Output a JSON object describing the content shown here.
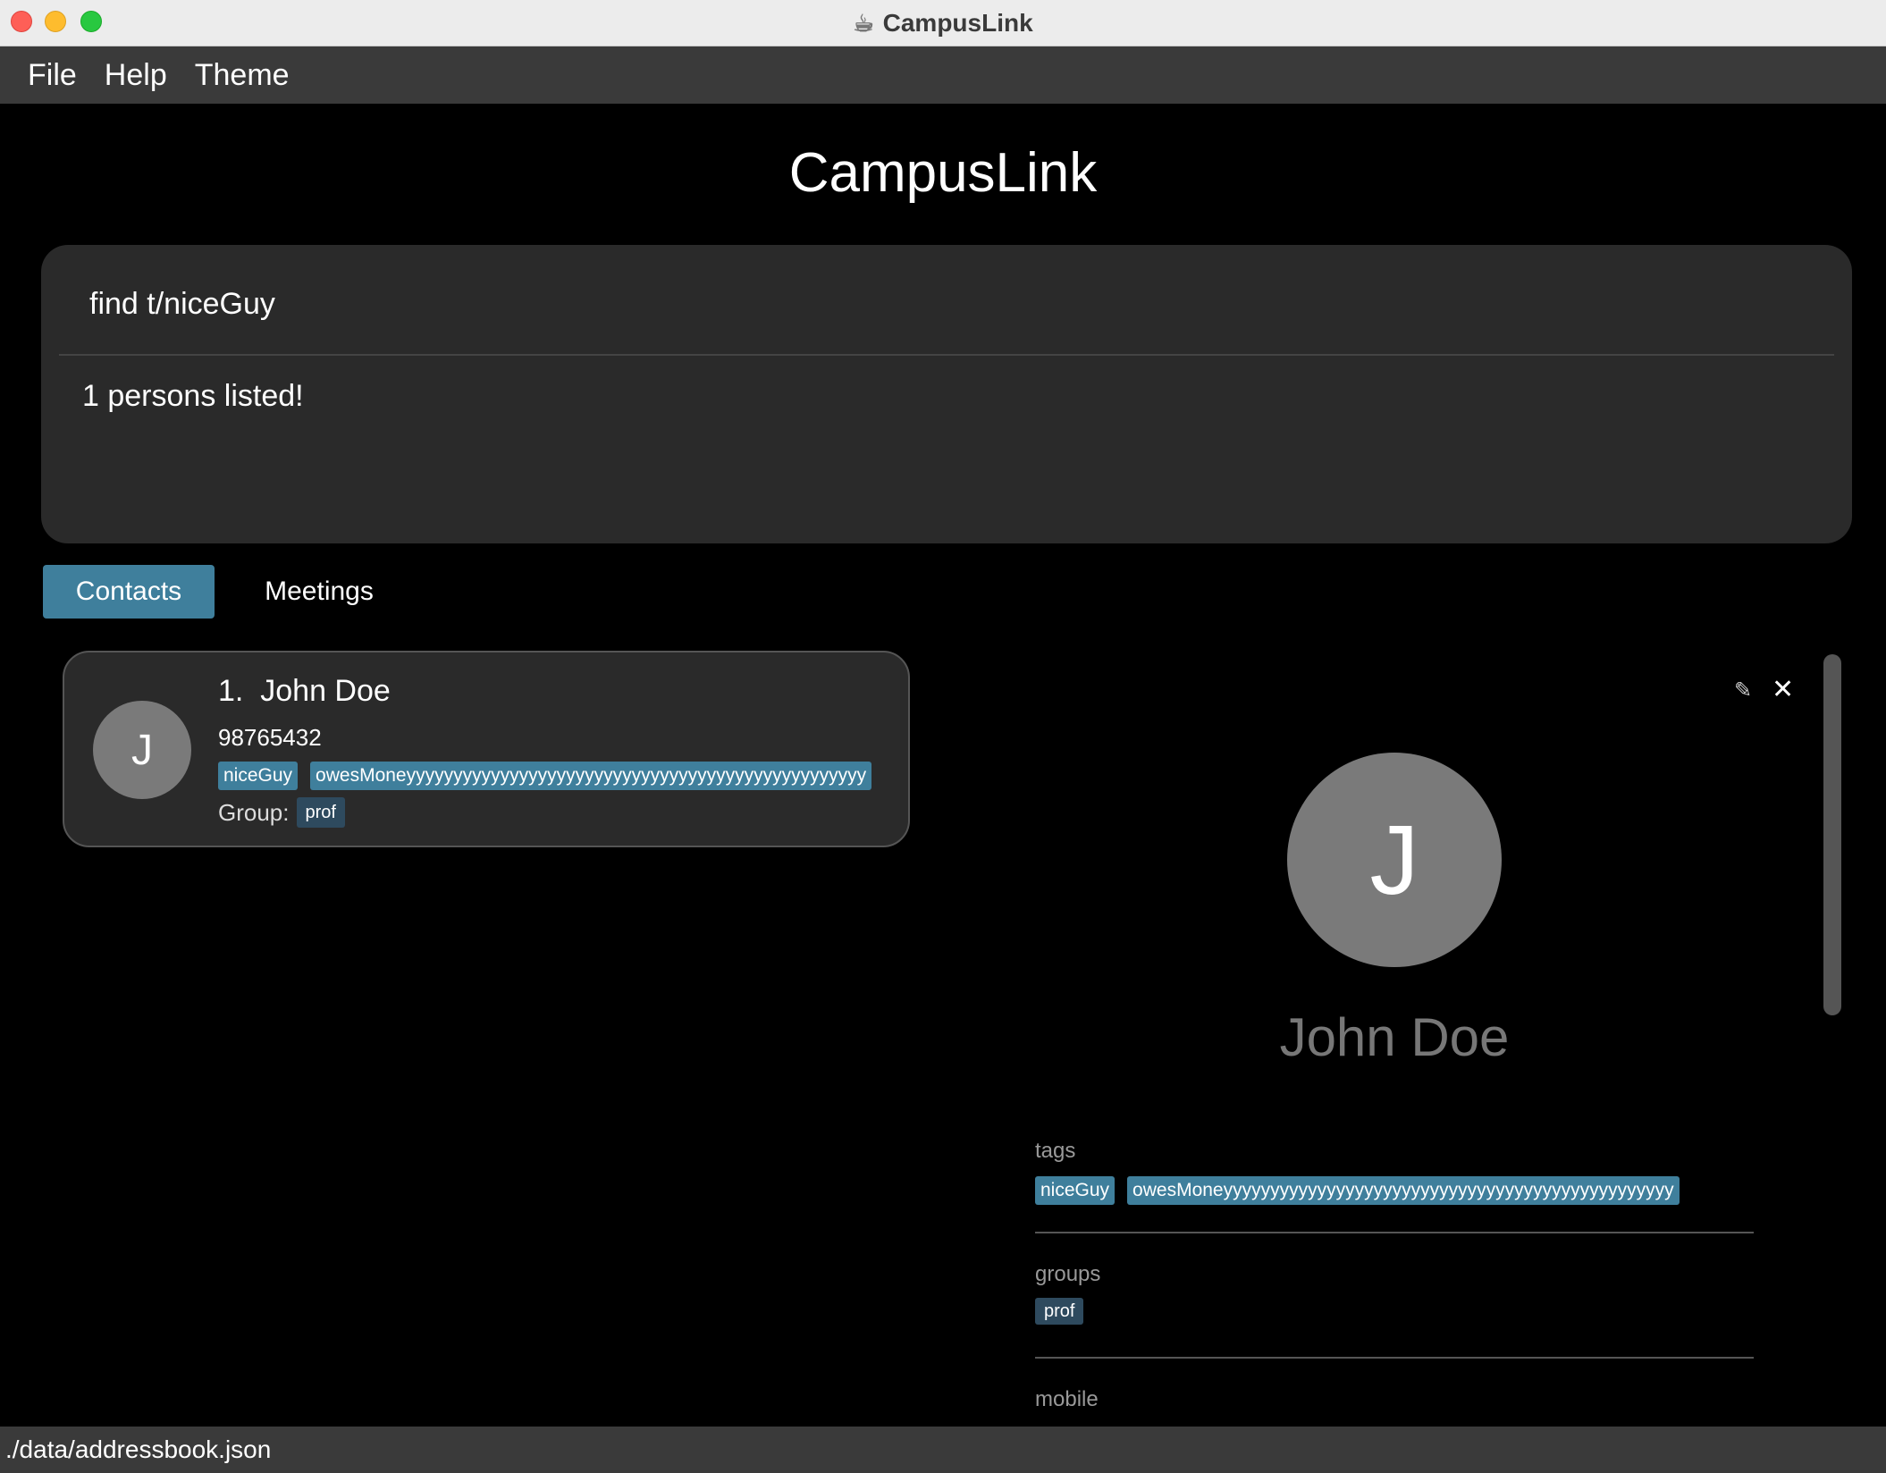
{
  "window": {
    "title": "CampusLink"
  },
  "menu": {
    "file": "File",
    "help": "Help",
    "theme": "Theme"
  },
  "header": {
    "title": "CampusLink"
  },
  "command": {
    "input_value": "find t/niceGuy",
    "result": "1 persons listed!"
  },
  "tabs": [
    {
      "label": "Contacts",
      "active": true
    },
    {
      "label": "Meetings",
      "active": false
    }
  ],
  "contacts": [
    {
      "index_name": "1.  John Doe",
      "initial": "J",
      "phone": "98765432",
      "tags": [
        "niceGuy",
        "owesMoneyyyyyyyyyyyyyyyyyyyyyyyyyyyyyyyyyyyyyyyyyyyyyyyyy"
      ],
      "group_label": "Group:",
      "group": "prof"
    }
  ],
  "detail": {
    "initial": "J",
    "name": "John Doe",
    "edit_icon": "✎",
    "close_icon": "✕",
    "tags_label": "tags",
    "tags": [
      "niceGuy",
      "owesMoneyyyyyyyyyyyyyyyyyyyyyyyyyyyyyyyyyyyyyyyyyyyyyyyy"
    ],
    "groups_label": "groups",
    "group": "prof",
    "mobile_label": "mobile"
  },
  "status": {
    "path": "./data/addressbook.json"
  },
  "colors": {
    "accent": "#3f7f9c",
    "group_chip": "#2e4a5e",
    "panel": "#2a2a2a",
    "background": "#000000"
  }
}
